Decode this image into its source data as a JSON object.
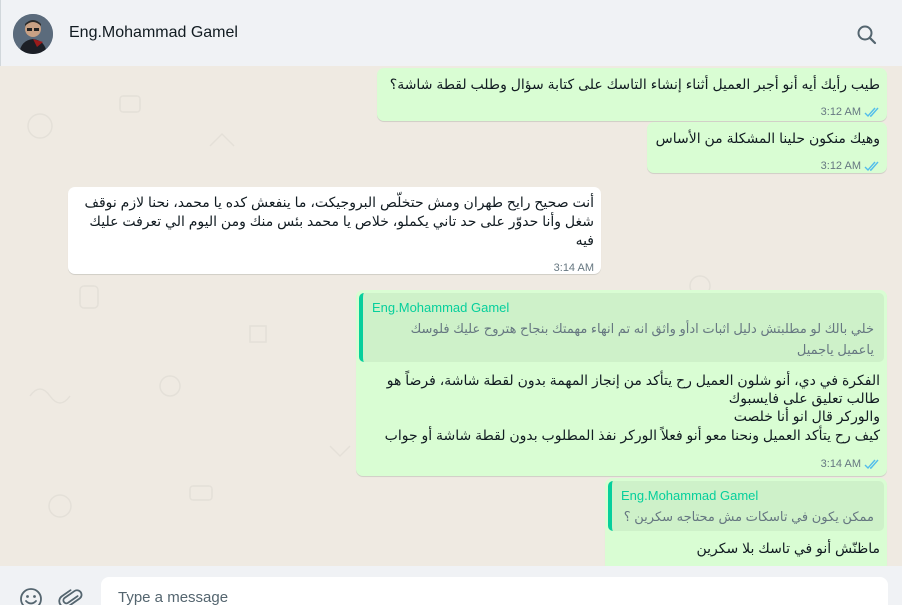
{
  "header": {
    "contact_name": "Eng.Mohammad Gamel"
  },
  "messages": [
    {
      "direction": "outgoing",
      "lines": [
        "طيب رأيك أيه أنو أجبر العميل أثناء إنشاء التاسك على كتابة سؤال وطلب لقطة شاشة؟"
      ],
      "time": "3:12 AM",
      "read": true
    },
    {
      "direction": "outgoing",
      "lines": [
        "وهيك منكون حلينا المشكلة من الأساس"
      ],
      "time": "3:12 AM",
      "read": true
    },
    {
      "direction": "incoming",
      "lines": [
        "أنت صحيح رايح طهران ومش حتخلّص البروجيكت، ما ينفعش كده يا محمد، نحنا لازم نوقف",
        "شغل وأنا حدوّر على حد تاني يكملو، خلاص يا محمد بئس منك ومن اليوم الي تعرفت عليك",
        "فيه"
      ],
      "time": "3:14 AM"
    },
    {
      "direction": "outgoing",
      "quote": {
        "author": "Eng.Mohammad Gamel",
        "lines": [
          "خلي بالك لو مطلبتش دليل اثبات ادأو واثق انه تم انهاء مهمتك بنجاح هتروح عليك فلوسك",
          "ياعميل ياجميل"
        ]
      },
      "lines": [
        "الفكرة في دي، أنو شلون العميل رح يتأكد من إنجاز المهمة بدون لقطة شاشة، فرضاً هو",
        "طالب تعليق على فايسبوك",
        "والوركر قال انو أنا خلصت",
        "كيف رح يتأكد العميل ونحنا معو أنو فعلاً الوركر نفذ المطلوب بدون لقطة شاشة أو جواب"
      ],
      "time": "3:14 AM",
      "read": true
    },
    {
      "direction": "outgoing",
      "quote": {
        "author": "Eng.Mohammad Gamel",
        "lines": [
          "ممكن يكون في تاسكات مش محتاجه سكرين ؟"
        ]
      },
      "lines": [
        "ماظنّش أنو في تاسك بلا سكرين"
      ]
    }
  ],
  "composer": {
    "placeholder": "Type a message"
  },
  "icons": {
    "search": "search-icon",
    "emoji": "emoji-icon",
    "attach": "paperclip-icon",
    "ticks": "double-check-icon"
  },
  "colors": {
    "outgoing_bubble": "#d9fdd3",
    "incoming_bubble": "#ffffff",
    "read_ticks": "#53bdeb",
    "quote_accent": "#06cf9c"
  }
}
